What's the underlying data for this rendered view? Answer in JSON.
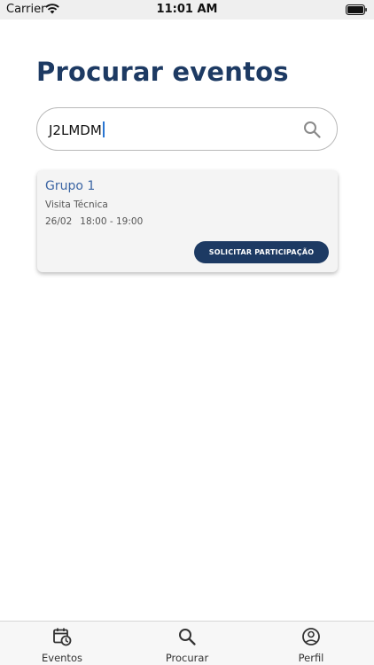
{
  "status_bar": {
    "carrier": "Carrier",
    "time": "11:01 AM"
  },
  "page": {
    "title": "Procurar eventos"
  },
  "search": {
    "value": "J2LMDM"
  },
  "results": [
    {
      "title": "Grupo 1",
      "type": "Visita Técnica",
      "date": "26/02",
      "time": "18:00 - 19:00",
      "button_label": "SOLICITAR PARTICIPAÇÃO"
    }
  ],
  "tab_bar": {
    "items": [
      {
        "label": "Eventos",
        "icon": "calendar-clock-icon"
      },
      {
        "label": "Procurar",
        "icon": "search-icon"
      },
      {
        "label": "Perfil",
        "icon": "user-circle-icon"
      }
    ]
  },
  "colors": {
    "primary": "#1d3a63",
    "link": "#3a64a3",
    "card_bg": "#f4f4f4"
  }
}
